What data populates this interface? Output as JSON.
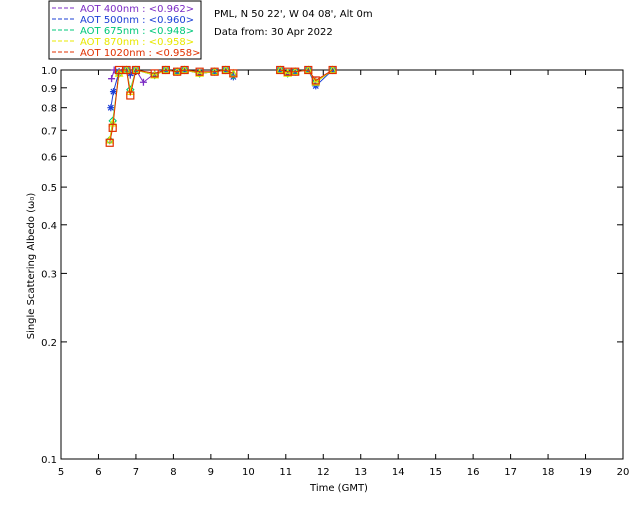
{
  "header": {
    "site": "PML, N 50 22', W 04 08', Alt 0m",
    "date_line": "Data from: 30 Apr 2022"
  },
  "chart_data": {
    "type": "scatter",
    "title": "",
    "xlabel": "Time (GMT)",
    "ylabel": "Single Scattering Albedo (ω₀)",
    "xlim": [
      5,
      20
    ],
    "ylim": [
      0.1,
      1.0
    ],
    "yscale": "log",
    "x_ticks": [
      5,
      6,
      7,
      8,
      9,
      10,
      11,
      12,
      13,
      14,
      15,
      16,
      17,
      18,
      19,
      20
    ],
    "y_ticks": [
      0.1,
      0.2,
      0.3,
      0.4,
      0.5,
      0.6,
      0.7,
      0.8,
      0.9,
      1.0
    ],
    "y_tick_labels": [
      "0.1",
      "0.2",
      "0.3",
      "0.4",
      "0.5",
      "0.6",
      "0.7",
      "0.8",
      "0.9",
      "1.0"
    ],
    "legend_position": "top-left, above plot",
    "series": [
      {
        "name": "AOT  400nm : <0.962>",
        "color": "#7b2cc4",
        "marker": "plus",
        "x": [
          6.35,
          6.42,
          6.55,
          6.75,
          6.85,
          7.0,
          7.2,
          7.5,
          7.8,
          8.1,
          8.3,
          8.7,
          9.1,
          9.4,
          9.6,
          10.85,
          11.05,
          11.25,
          11.6,
          11.8,
          12.25
        ],
        "y": [
          0.95,
          1.0,
          0.99,
          1.0,
          0.97,
          1.0,
          0.93,
          0.98,
          1.0,
          0.99,
          1.0,
          0.98,
          0.99,
          1.0,
          0.97,
          1.0,
          0.98,
          0.99,
          1.0,
          0.94,
          1.0
        ]
      },
      {
        "name": "AOT  500nm : <0.960>",
        "color": "#1b3fd6",
        "marker": "asterisk",
        "x": [
          6.33,
          6.4,
          6.55,
          6.75,
          6.85,
          7.0,
          7.5,
          7.8,
          8.1,
          8.3,
          8.7,
          9.1,
          9.4,
          9.6,
          10.85,
          11.05,
          11.25,
          11.6,
          11.8,
          12.25
        ],
        "y": [
          0.8,
          0.88,
          0.99,
          1.0,
          0.98,
          1.0,
          0.97,
          1.0,
          0.99,
          1.0,
          0.98,
          0.99,
          1.0,
          0.96,
          1.0,
          0.98,
          0.99,
          1.0,
          0.91,
          1.0
        ]
      },
      {
        "name": "AOT  675nm : <0.948>",
        "color": "#00c87a",
        "marker": "diamond",
        "x": [
          6.3,
          6.38,
          6.55,
          6.75,
          6.85,
          7.0,
          7.5,
          7.8,
          8.1,
          8.3,
          8.7,
          9.1,
          9.4,
          9.6,
          10.85,
          11.05,
          11.25,
          11.6,
          11.8,
          12.25
        ],
        "y": [
          0.66,
          0.74,
          0.98,
          1.0,
          0.89,
          1.0,
          0.97,
          1.0,
          0.99,
          1.0,
          0.98,
          0.99,
          1.0,
          0.97,
          1.0,
          0.98,
          0.99,
          1.0,
          0.93,
          1.0
        ]
      },
      {
        "name": "AOT  870nm : <0.958>",
        "color": "#e8e800",
        "marker": "triangle",
        "x": [
          6.3,
          6.38,
          6.55,
          6.75,
          6.85,
          7.0,
          7.5,
          7.8,
          8.1,
          8.3,
          8.7,
          9.1,
          9.4,
          9.6,
          10.85,
          11.05,
          11.25,
          11.6,
          11.8,
          12.25
        ],
        "y": [
          0.66,
          0.73,
          0.98,
          1.0,
          0.88,
          1.0,
          0.97,
          1.0,
          0.99,
          1.0,
          0.98,
          0.99,
          1.0,
          0.98,
          1.0,
          0.98,
          0.99,
          1.0,
          0.93,
          1.0
        ]
      },
      {
        "name": "AOT 1020nm : <0.958>",
        "color": "#e03000",
        "marker": "square",
        "x": [
          6.3,
          6.38,
          6.55,
          6.75,
          6.85,
          7.0,
          7.5,
          7.8,
          8.1,
          8.3,
          8.7,
          9.1,
          9.4,
          9.6,
          10.85,
          11.05,
          11.25,
          11.6,
          11.8,
          12.25
        ],
        "y": [
          0.65,
          0.71,
          1.0,
          1.0,
          0.86,
          1.0,
          0.98,
          1.0,
          0.99,
          1.0,
          0.99,
          0.99,
          1.0,
          0.98,
          1.0,
          0.99,
          0.99,
          1.0,
          0.94,
          1.0
        ]
      }
    ]
  }
}
